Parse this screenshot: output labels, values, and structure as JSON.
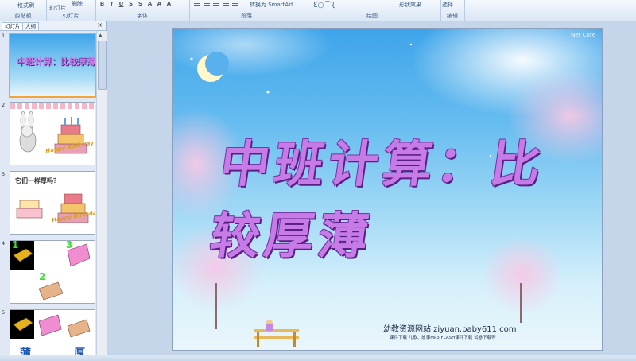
{
  "ribbon": {
    "groups": [
      {
        "label": "剪贴板"
      },
      {
        "label": "幻灯片"
      },
      {
        "label": "字体"
      },
      {
        "label": "段落"
      },
      {
        "label": "绘图"
      },
      {
        "label": "编辑"
      }
    ],
    "copy_format": "格式刷",
    "new_slide": "幻灯片",
    "delete": "删除",
    "smartart": "转换为 SmartArt",
    "shape_effects": "形状效果",
    "select": "选择"
  },
  "panel": {
    "tabs": [
      {
        "label": "幻灯片"
      },
      {
        "label": "大纲"
      }
    ],
    "close": "×",
    "slides": [
      {
        "num": "1",
        "title": "中班计算：比较厚薄"
      },
      {
        "num": "2",
        "text": "Happy Birthday"
      },
      {
        "num": "3",
        "text": "它们一样厚吗？",
        "text2": "Happy Birthday"
      },
      {
        "num": "4",
        "labels": [
          "1",
          "3",
          "2"
        ]
      },
      {
        "num": "5",
        "words": [
          "薄",
          "厚"
        ]
      }
    ]
  },
  "slide": {
    "title": "中班计算：比较厚薄",
    "site": "幼教资源网站  ziyuan.baby611.com",
    "sub": "课件下载    儿歌、故事MP3    FLASH课件下载    试卷下载等",
    "watermark": "Net Cute"
  },
  "colors": {
    "title": "#c67be7",
    "selection": "#f3a53a"
  }
}
